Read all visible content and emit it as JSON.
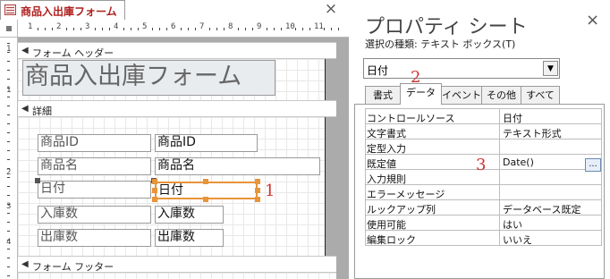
{
  "document_tab": {
    "icon": "form-icon",
    "title": "商品入出庫フォーム",
    "close_glyph": "×"
  },
  "rulers": {
    "h_numbers": [
      "1",
      "2",
      "3",
      "4",
      "5",
      "6",
      "7",
      "8",
      "9",
      "10",
      "11"
    ],
    "v_numbers": [
      "1",
      "1",
      "2",
      "3",
      "4"
    ]
  },
  "sections": {
    "header": "フォーム ヘッダー",
    "detail": "詳細",
    "footer": "フォーム フッター",
    "marker": "◀"
  },
  "form_title": "商品入出庫フォーム",
  "controls": {
    "rows": [
      {
        "label": "商品ID",
        "field": "商品ID"
      },
      {
        "label": "商品名",
        "field": "商品名"
      },
      {
        "label": "日付",
        "field": "日付"
      },
      {
        "label": "入庫数",
        "field": "入庫数"
      },
      {
        "label": "出庫数",
        "field": "出庫数"
      }
    ]
  },
  "annotations": {
    "one": "1",
    "two": "2",
    "three": "3"
  },
  "property_sheet": {
    "title": "プロパティ シート",
    "selection_type_label": "選択の種類: テキスト ボックス(T)",
    "close_glyph": "×",
    "selected_object": "日付",
    "dropdown_glyph": "▼",
    "tabs": [
      "書式",
      "データ",
      "イベント",
      "その他",
      "すべて"
    ],
    "active_tab": "データ",
    "properties": [
      {
        "name": "コントロールソース",
        "value": "日付"
      },
      {
        "name": "文字書式",
        "value": "テキスト形式"
      },
      {
        "name": "定型入力",
        "value": ""
      },
      {
        "name": "既定値",
        "value": "Date()"
      },
      {
        "name": "入力規則",
        "value": ""
      },
      {
        "name": "エラーメッセージ",
        "value": ""
      },
      {
        "name": "ルックアップ列",
        "value": "データベース既定"
      },
      {
        "name": "使用可能",
        "value": "はい"
      },
      {
        "name": "編集ロック",
        "value": "いいえ"
      }
    ],
    "builder_button": "..."
  },
  "colors": {
    "annotation_red": "#d03030",
    "selection_orange": "#e8943a",
    "tab_title_red": "#b02020"
  }
}
